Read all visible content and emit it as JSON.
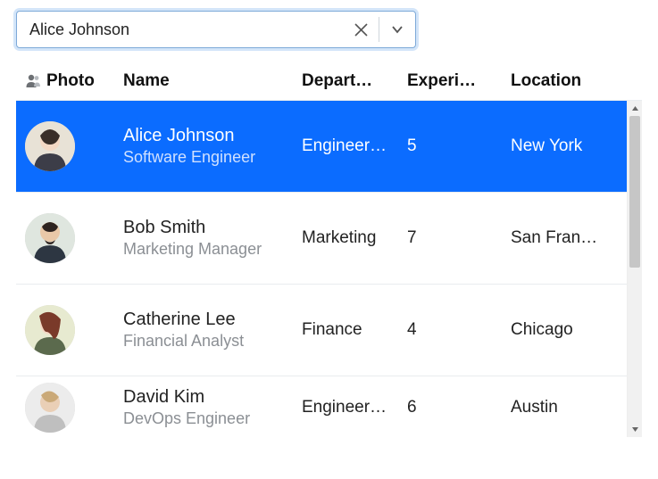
{
  "search": {
    "value": "Alice Johnson",
    "placeholder": "",
    "clear_icon": "clear-icon",
    "dropdown_icon": "chevron-down-icon"
  },
  "columns": {
    "photo": "Photo",
    "name": "Name",
    "department": "Depart…",
    "experience": "Experi…",
    "location": "Location"
  },
  "rows": [
    {
      "name": "Alice Johnson",
      "role": "Software Engineer",
      "department": "Engineer…",
      "experience": "5",
      "location": "New York",
      "selected": true
    },
    {
      "name": "Bob Smith",
      "role": "Marketing Manager",
      "department": "Marketing",
      "experience": "7",
      "location": "San Fran…",
      "selected": false
    },
    {
      "name": "Catherine Lee",
      "role": "Financial Analyst",
      "department": "Finance",
      "experience": "4",
      "location": "Chicago",
      "selected": false
    },
    {
      "name": "David Kim",
      "role": "DevOps Engineer",
      "department": "Engineer…",
      "experience": "6",
      "location": "Austin",
      "selected": false
    }
  ],
  "colors": {
    "selection": "#0b6cff",
    "focus_ring": "rgba(80,150,230,.25)"
  }
}
